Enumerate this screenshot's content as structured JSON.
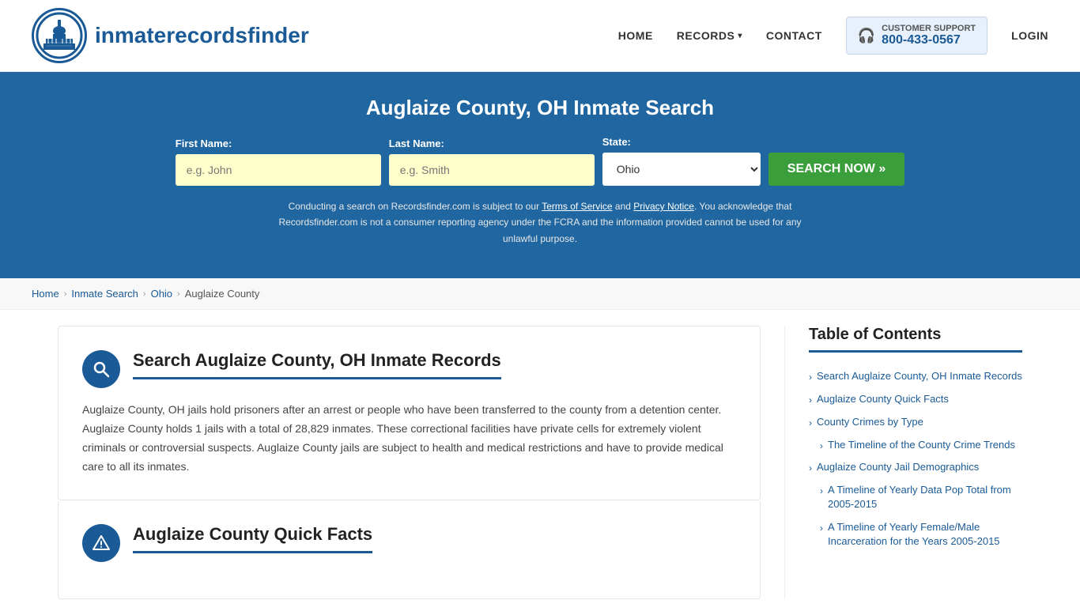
{
  "header": {
    "logo_text_regular": "inmaterecords",
    "logo_text_bold": "finder",
    "nav": {
      "home": "HOME",
      "records": "RECORDS",
      "contact": "CONTACT",
      "login": "LOGIN"
    },
    "customer_support_label": "CUSTOMER SUPPORT",
    "customer_support_number": "800-433-0567"
  },
  "hero": {
    "title": "Auglaize County, OH Inmate Search",
    "form": {
      "first_name_label": "First Name:",
      "first_name_placeholder": "e.g. John",
      "last_name_label": "Last Name:",
      "last_name_placeholder": "e.g. Smith",
      "state_label": "State:",
      "state_value": "Ohio",
      "search_button": "SEARCH NOW »"
    },
    "disclaimer": "Conducting a search on Recordsfinder.com is subject to our Terms of Service and Privacy Notice. You acknowledge that Recordsfinder.com is not a consumer reporting agency under the FCRA and the information provided cannot be used for any unlawful purpose."
  },
  "breadcrumb": {
    "home": "Home",
    "inmate_search": "Inmate Search",
    "ohio": "Ohio",
    "county": "Auglaize County"
  },
  "section1": {
    "title": "Search Auglaize County, OH Inmate Records",
    "body": "Auglaize County, OH jails hold prisoners after an arrest or people who have been transferred to the county from a detention center. Auglaize County holds 1 jails with a total of 28,829 inmates. These correctional facilities have private cells for extremely violent criminals or controversial suspects. Auglaize County jails are subject to health and medical restrictions and have to provide medical care to all its inmates."
  },
  "section2": {
    "title": "Auglaize County Quick Facts"
  },
  "toc": {
    "title": "Table of Contents",
    "items": [
      {
        "label": "Search Auglaize County, OH Inmate Records",
        "indent": false
      },
      {
        "label": "Auglaize County Quick Facts",
        "indent": false
      },
      {
        "label": "County Crimes by Type",
        "indent": false
      },
      {
        "label": "The Timeline of the County Crime Trends",
        "indent": true
      },
      {
        "label": "Auglaize County Jail Demographics",
        "indent": false
      },
      {
        "label": "A Timeline of Yearly Data Pop Total from 2005-2015",
        "indent": true
      },
      {
        "label": "A Timeline of Yearly Female/Male Incarceration for the Years 2005-2015",
        "indent": true
      }
    ]
  }
}
